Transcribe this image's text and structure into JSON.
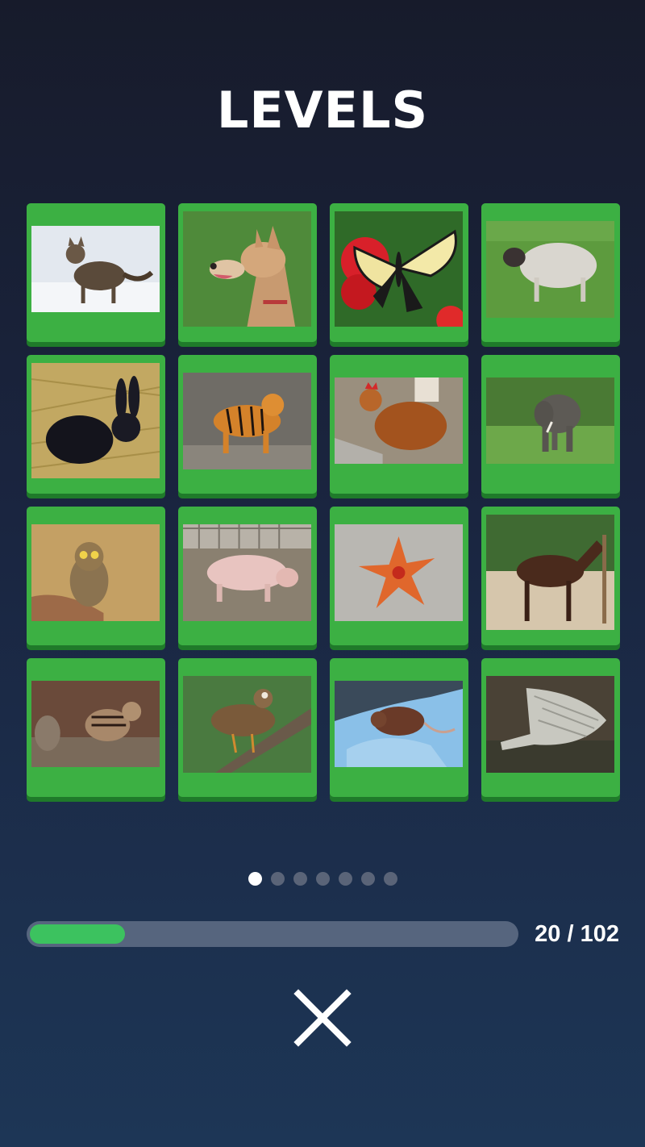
{
  "title": "LEVELS",
  "levels": [
    {
      "name": "cat-level"
    },
    {
      "name": "dog-level"
    },
    {
      "name": "butterfly-level"
    },
    {
      "name": "sheep-level"
    },
    {
      "name": "rabbit-level"
    },
    {
      "name": "tiger-level"
    },
    {
      "name": "chicken-level"
    },
    {
      "name": "elephant-level"
    },
    {
      "name": "owl-level"
    },
    {
      "name": "pig-level"
    },
    {
      "name": "starfish-level"
    },
    {
      "name": "horse-level"
    },
    {
      "name": "chipmunk-level"
    },
    {
      "name": "duck-level"
    },
    {
      "name": "mouse-level"
    },
    {
      "name": "crocodile-level"
    }
  ],
  "pagination": {
    "pages": 7,
    "current": 1
  },
  "progress": {
    "text": "20 / 102",
    "completed": 20,
    "total": 102
  },
  "close_icon": "close-icon",
  "colors": {
    "tile_green": "#3cb043",
    "progress_fill": "#3cc25f",
    "progress_track": "#56657e"
  }
}
